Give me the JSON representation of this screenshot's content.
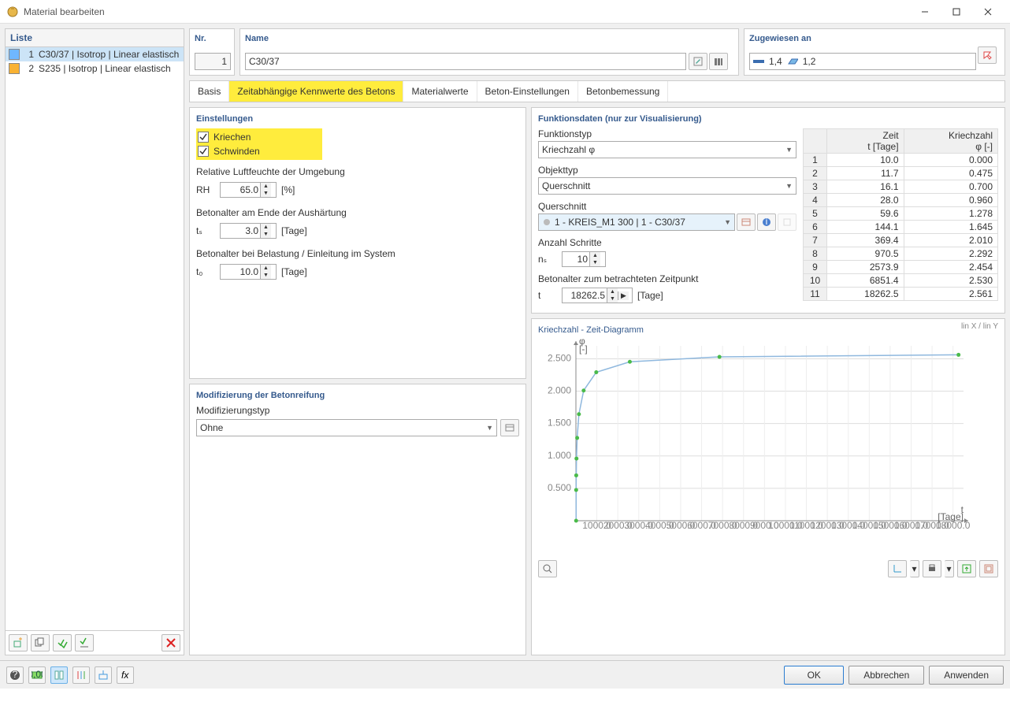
{
  "window": {
    "title": "Material bearbeiten"
  },
  "list": {
    "header": "Liste",
    "items": [
      {
        "num": "1",
        "name": "C30/37 | Isotrop | Linear elastisch",
        "color": "#6fb7ff",
        "selected": true
      },
      {
        "num": "2",
        "name": "S235 | Isotrop | Linear elastisch",
        "color": "#f9b233",
        "selected": false
      }
    ]
  },
  "nr": {
    "label": "Nr.",
    "value": "1"
  },
  "name": {
    "label": "Name",
    "value": "C30/37"
  },
  "assigned": {
    "label": "Zugewiesen an",
    "bars": "1,4",
    "surfaces": "1,2"
  },
  "tabs": [
    "Basis",
    "Zeitabhängige Kennwerte des Betons",
    "Materialwerte",
    "Beton-Einstellungen",
    "Betonbemessung"
  ],
  "activeTab": 1,
  "settings": {
    "header": "Einstellungen",
    "kriechen": "Kriechen",
    "schwinden": "Schwinden",
    "rh_label": "Relative Luftfeuchte der Umgebung",
    "rh_sym": "RH",
    "rh_val": "65.0",
    "rh_unit": "[%]",
    "ts_label": "Betonalter am Ende der Aushärtung",
    "ts_sym": "tₛ",
    "ts_val": "3.0",
    "ts_unit": "[Tage]",
    "t0_label": "Betonalter bei Belastung / Einleitung im System",
    "t0_sym": "t₀",
    "t0_val": "10.0",
    "t0_unit": "[Tage]"
  },
  "mod": {
    "header": "Modifizierung der Betonreifung",
    "typelabel": "Modifizierungstyp",
    "value": "Ohne"
  },
  "func": {
    "header": "Funktionsdaten (nur zur Visualisierung)",
    "ftype_label": "Funktionstyp",
    "ftype": "Kriechzahl φ",
    "otype_label": "Objekttyp",
    "otype": "Querschnitt",
    "qs_label": "Querschnitt",
    "qs": "1 - KREIS_M1 300 | 1 - C30/37",
    "steps_label": "Anzahl Schritte",
    "steps_sym": "nₛ",
    "steps": "10",
    "t_label": "Betonalter zum betrachteten Zeitpunkt",
    "t_sym": "t",
    "t_val": "18262.5",
    "t_unit": "[Tage]"
  },
  "tablehdr": {
    "col1": "Zeit",
    "col1u": "t [Tage]",
    "col2": "Kriechzahl",
    "col2u": "φ [-]"
  },
  "chart_data": {
    "type": "line",
    "title": "Kriechzahl - Zeit-Diagramm",
    "xlabel": "t",
    "xunit": "[Tage]",
    "ylabel": "φ",
    "yunit": "[-]",
    "axis_mode": "lin X / lin Y",
    "x": [
      10.0,
      11.7,
      16.1,
      28.0,
      59.6,
      144.1,
      369.4,
      970.5,
      2573.9,
      6851.4,
      18262.5
    ],
    "y": [
      0.0,
      0.475,
      0.7,
      0.96,
      1.278,
      1.645,
      2.01,
      2.292,
      2.454,
      2.53,
      2.561
    ],
    "xlim": [
      0,
      18500
    ],
    "ylim": [
      0,
      2.7
    ],
    "xticks": [
      1000,
      2000,
      3000,
      4000,
      5000,
      6000,
      7000,
      8000,
      9000,
      10000,
      11000,
      12000,
      13000,
      14000,
      15000,
      16000,
      17000,
      18000
    ],
    "yticks": [
      0.5,
      1.0,
      1.5,
      2.0,
      2.5
    ]
  },
  "buttons": {
    "ok": "OK",
    "cancel": "Abbrechen",
    "apply": "Anwenden"
  }
}
